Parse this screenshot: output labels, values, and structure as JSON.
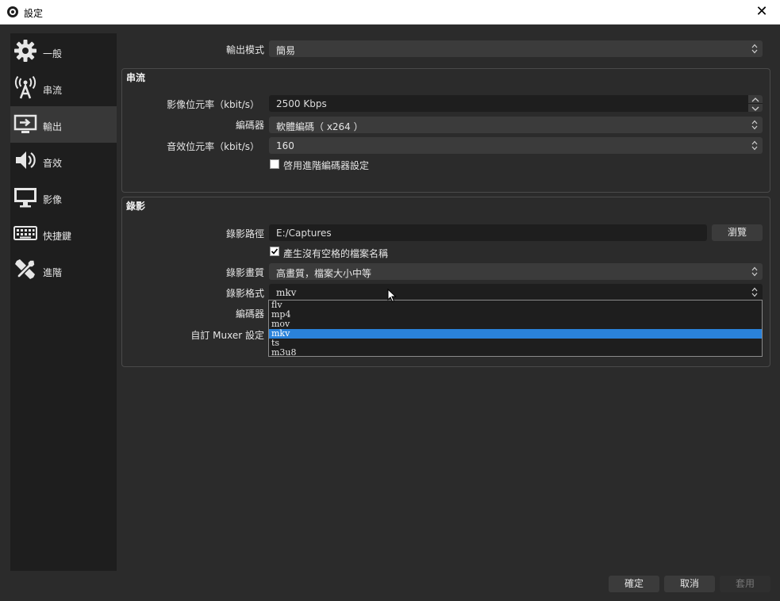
{
  "window": {
    "title": "設定",
    "close_glyph": "✕"
  },
  "sidebar": {
    "items": [
      {
        "label": "一般",
        "icon": "gear-icon"
      },
      {
        "label": "串流",
        "icon": "broadcast-icon"
      },
      {
        "label": "輸出",
        "icon": "output-icon",
        "active": true
      },
      {
        "label": "音效",
        "icon": "speaker-icon"
      },
      {
        "label": "影像",
        "icon": "monitor-icon"
      },
      {
        "label": "快捷鍵",
        "icon": "keyboard-icon"
      },
      {
        "label": "進階",
        "icon": "tools-icon"
      }
    ]
  },
  "output_mode": {
    "label": "輸出模式",
    "value": "簡易"
  },
  "streaming": {
    "title": "串流",
    "video_bitrate": {
      "label": "影像位元率（kbit/s）",
      "value": "2500 Kbps"
    },
    "encoder": {
      "label": "編碼器",
      "value": "軟體編碼（ x264 ）"
    },
    "audio_bitrate": {
      "label": "音效位元率（kbit/s）",
      "value": "160"
    },
    "advanced_encoder": {
      "label": "啓用進階編碼器設定",
      "checked": false
    }
  },
  "recording": {
    "title": "錄影",
    "path": {
      "label": "錄影路徑",
      "value": "E:/Captures"
    },
    "browse_button": "瀏覽",
    "no_space": {
      "label": "產生沒有空格的檔案名稱",
      "checked": true
    },
    "quality": {
      "label": "錄影畫質",
      "value": "高畫質，檔案大小中等"
    },
    "format": {
      "label": "錄影格式",
      "value": "mkv",
      "options": [
        "flv",
        "mp4",
        "mov",
        "mkv",
        "ts",
        "m3u8"
      ],
      "selected_index": 3
    },
    "encoder": {
      "label": "編碼器"
    },
    "muxer": {
      "label": "自訂 Muxer 設定"
    }
  },
  "footer": {
    "ok": "確定",
    "cancel": "取消",
    "apply": "套用"
  },
  "colors": {
    "accent": "#2a82da",
    "panel": "#2b2b2b",
    "sidebar": "#1e1e1e",
    "field": "#3b3b3b"
  }
}
